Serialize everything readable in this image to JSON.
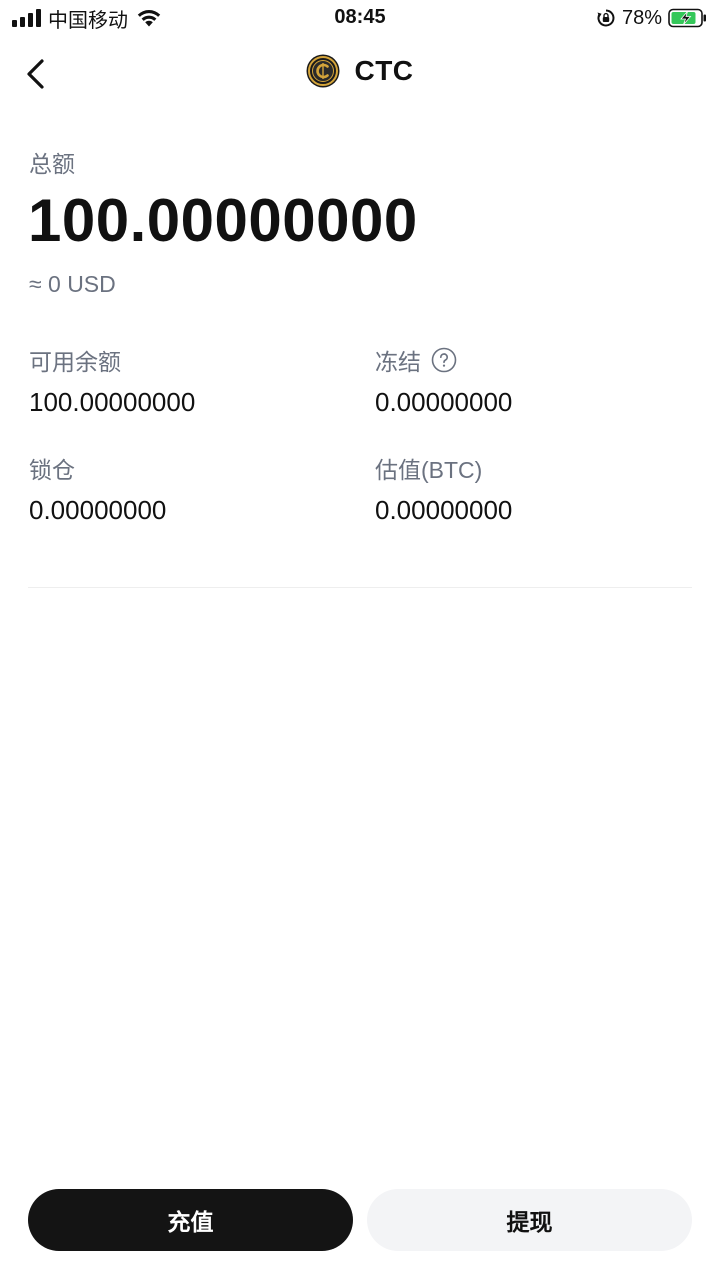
{
  "status_bar": {
    "carrier": "中国移动",
    "time": "08:45",
    "battery": "78%"
  },
  "nav": {
    "title": "CTC",
    "coin_icon": "ctc-coin-icon",
    "back_icon": "chevron-left-icon"
  },
  "summary": {
    "total_label": "总额",
    "total_amount": "100.00000000",
    "usd_approx": "≈ 0 USD"
  },
  "stats": {
    "available": {
      "label": "可用余额",
      "value": "100.00000000"
    },
    "frozen": {
      "label": "冻结",
      "value": "0.00000000"
    },
    "locked": {
      "label": "锁仓",
      "value": "0.00000000"
    },
    "valuation": {
      "label": "估值(BTC)",
      "value": "0.00000000"
    }
  },
  "actions": {
    "deposit": "充值",
    "withdraw": "提现"
  },
  "colors": {
    "primary_button": "#141414",
    "secondary_button": "#f3f4f6",
    "muted_text": "#6b7280",
    "battery_green": "#34c759",
    "coin_gold": "#d4a43a"
  }
}
